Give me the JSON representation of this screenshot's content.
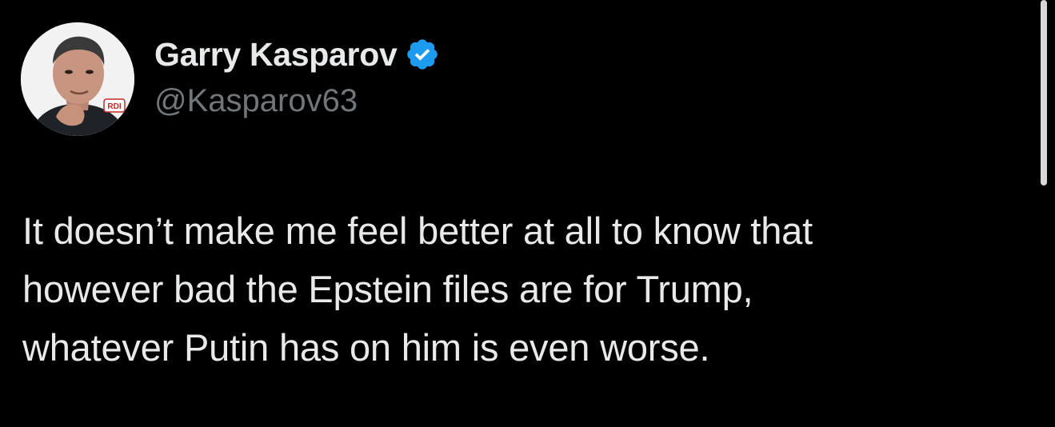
{
  "author": {
    "display_name": "Garry Kasparov",
    "handle": "@Kasparov63",
    "verified": true,
    "verified_icon": "verified-badge-icon",
    "avatar_badge_text": "RDI"
  },
  "tweet": {
    "lines": [
      "It doesn’t make me feel better at all to know that",
      "however bad the Epstein files are for Trump,",
      "whatever Putin has on him is even worse."
    ]
  },
  "colors": {
    "background": "#000000",
    "text_primary": "#e7e9ea",
    "text_secondary": "#71767b",
    "verified_blue": "#1d9bf0"
  }
}
